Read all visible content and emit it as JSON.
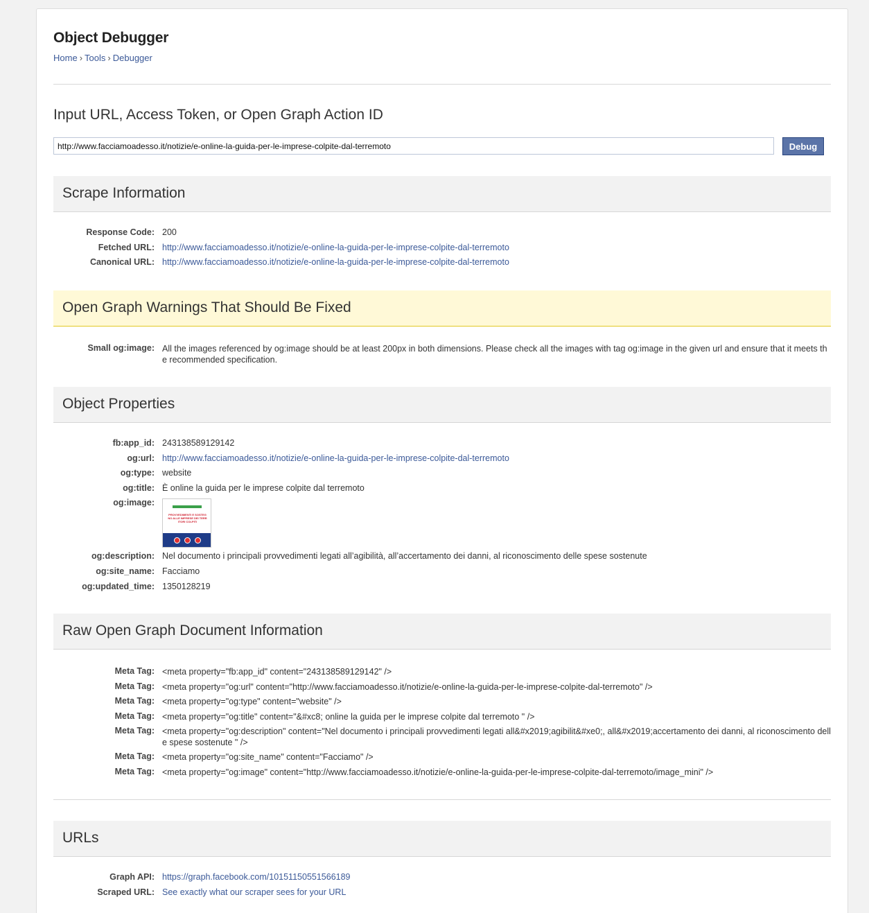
{
  "page": {
    "title": "Object Debugger",
    "breadcrumb": [
      "Home",
      "Tools",
      "Debugger"
    ],
    "breadcrumb_sep": "›"
  },
  "input": {
    "heading": "Input URL, Access Token, or Open Graph Action ID",
    "value": "http://www.facciamoadesso.it/notizie/e-online-la-guida-per-le-imprese-colpite-dal-terremoto",
    "button_label": "Debug"
  },
  "scrape": {
    "heading": "Scrape Information",
    "rows": [
      {
        "key": "Response Code:",
        "value": "200",
        "link": false
      },
      {
        "key": "Fetched URL:",
        "value": "http://www.facciamoadesso.it/notizie/e-online-la-guida-per-le-imprese-colpite-dal-terremoto",
        "link": true
      },
      {
        "key": "Canonical URL:",
        "value": "http://www.facciamoadesso.it/notizie/e-online-la-guida-per-le-imprese-colpite-dal-terremoto",
        "link": true
      }
    ]
  },
  "warnings": {
    "heading": "Open Graph Warnings That Should Be Fixed",
    "rows": [
      {
        "key": "Small og:image:",
        "value": "All the images referenced by og:image should be at least 200px in both dimensions. Please check all the images with tag og:image in the given url and ensure that it meets the recommended specification."
      }
    ]
  },
  "properties": {
    "heading": "Object Properties",
    "rows": [
      {
        "key": "fb:app_id:",
        "value": "243138589129142",
        "link": false
      },
      {
        "key": "og:url:",
        "value": "http://www.facciamoadesso.it/notizie/e-online-la-guida-per-le-imprese-colpite-dal-terremoto",
        "link": true
      },
      {
        "key": "og:type:",
        "value": "website",
        "link": false
      },
      {
        "key": "og:title:",
        "value": "È online la guida per le imprese colpite dal terremoto",
        "link": false
      },
      {
        "key": "og:image:",
        "value": "",
        "image": true
      },
      {
        "key": "og:description:",
        "value": "Nel documento i principali provvedimenti legati all’agibilità, all’accertamento dei danni, al riconoscimento delle spese sostenute",
        "link": false
      },
      {
        "key": "og:site_name:",
        "value": "Facciamo",
        "link": false
      },
      {
        "key": "og:updated_time:",
        "value": "1350128219",
        "link": false
      }
    ],
    "thumb_text": "PROVVEDIMENTI E SOSTEGNO ALLE IMPRESE DEI TERRITORI COLPITI"
  },
  "raw": {
    "heading": "Raw Open Graph Document Information",
    "rows": [
      {
        "key": "Meta Tag:",
        "value": "<meta property=\"fb:app_id\" content=\"243138589129142\" />"
      },
      {
        "key": "Meta Tag:",
        "value": "<meta property=\"og:url\" content=\"http://www.facciamoadesso.it/notizie/e-online-la-guida-per-le-imprese-colpite-dal-terremoto\" />"
      },
      {
        "key": "Meta Tag:",
        "value": "<meta property=\"og:type\" content=\"website\" />"
      },
      {
        "key": "Meta Tag:",
        "value": "<meta property=\"og:title\" content=\"&#xc8; online la guida per le imprese colpite dal terremoto \" />"
      },
      {
        "key": "Meta Tag:",
        "value": "<meta property=\"og:description\" content=\"Nel documento i principali provvedimenti legati all&#x2019;agibilit&#xe0;, all&#x2019;accertamento dei danni, al riconoscimento delle spese sostenute \" />"
      },
      {
        "key": "Meta Tag:",
        "value": "<meta property=\"og:site_name\" content=\"Facciamo\" />"
      },
      {
        "key": "Meta Tag:",
        "value": "<meta property=\"og:image\" content=\"http://www.facciamoadesso.it/notizie/e-online-la-guida-per-le-imprese-colpite-dal-terremoto/image_mini\" />"
      }
    ]
  },
  "urls": {
    "heading": "URLs",
    "rows": [
      {
        "key": "Graph API:",
        "value": "https://graph.facebook.com/10151150551566189",
        "link": true
      },
      {
        "key": "Scraped URL:",
        "value": "See exactly what our scraper sees for your URL",
        "link": true
      }
    ]
  }
}
